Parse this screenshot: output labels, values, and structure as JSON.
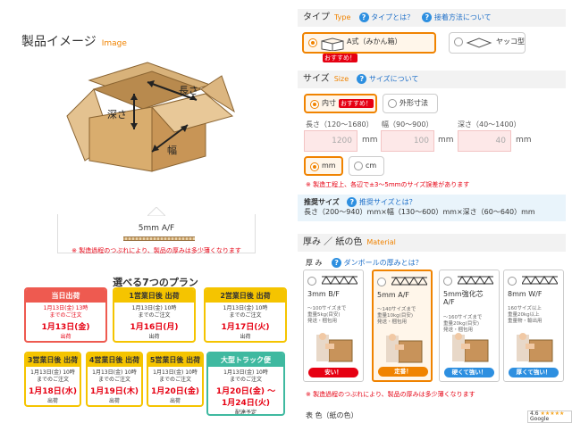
{
  "left": {
    "image_title": "製品イメージ",
    "image_title_en": "Image",
    "box_labels": {
      "length": "長さ",
      "depth": "深さ",
      "width": "幅"
    },
    "spec_name": "5mm A/F",
    "spec_note": "※ 製造過程のつぶれにより、製品の厚みは多少薄くなります",
    "plans_heading": "選べる7つのプラン",
    "plans": [
      {
        "head": "当日出荷",
        "line1": "1月13日(金) 13時",
        "line2": "までのご注文",
        "date": "1月13日(金)",
        "ship": "出荷",
        "style": "red"
      },
      {
        "head": "1営業日後 出荷",
        "line1": "1月13日(金) 10時",
        "line2": "までのご注文",
        "date": "1月16日(月)",
        "ship": "出荷",
        "style": "yellow"
      },
      {
        "head": "2営業日後 出荷",
        "line1": "1月13日(金) 10時",
        "line2": "までのご注文",
        "date": "1月17日(火)",
        "ship": "出荷",
        "style": "yellow"
      },
      {
        "head": "3営業日後 出荷",
        "line1": "1月13日(金) 10時",
        "line2": "までのご注文",
        "date": "1月18日(水)",
        "ship": "出荷",
        "style": "yellow"
      },
      {
        "head": "4営業日後 出荷",
        "line1": "1月13日(金) 10時",
        "line2": "までのご注文",
        "date": "1月19日(木)",
        "ship": "出荷",
        "style": "yellow"
      },
      {
        "head": "5営業日後 出荷",
        "line1": "1月13日(金) 10時",
        "line2": "までのご注文",
        "date": "1月20日(金)",
        "ship": "出荷",
        "style": "yellow"
      },
      {
        "head": "大型トラック便",
        "line1": "1月13日(金) 10時",
        "line2": "までのご注文",
        "date": "1月20日(金) ～",
        "date2": "1月24日(火)",
        "ship": "配達予定",
        "style": "green"
      }
    ]
  },
  "type_section": {
    "title": "タイプ",
    "title_en": "Type",
    "link1": "タイプとは？",
    "link2": "接着方法について",
    "options": [
      {
        "label": "A式（みかん箱）",
        "badge": "おすすめ！",
        "selected": true
      },
      {
        "label": "ヤッコ型",
        "selected": false
      }
    ]
  },
  "size_section": {
    "title": "サイズ",
    "title_en": "Size",
    "link": "サイズについて",
    "measure": [
      {
        "label": "内寸",
        "badge": "おすすめ！",
        "selected": true
      },
      {
        "label": "外形寸法",
        "selected": false
      }
    ],
    "length_label": "長さ（120～1680）",
    "width_label": "幅（90～900）",
    "depth_label": "深さ（40～1400）",
    "length_value": "1200",
    "width_value": "100",
    "depth_value": "40",
    "unit": "mm",
    "units": [
      {
        "label": "mm",
        "selected": true
      },
      {
        "label": "cm",
        "selected": false
      }
    ],
    "note": "※ 製造工程上、各辺で±3～5mmのサイズ誤差があります",
    "recommended_title": "推奨サイズ",
    "recommended_link": "推奨サイズとは？",
    "recommended_range": "長さ（200～940）mm×幅（130～600）mm×深さ（60～640）mm"
  },
  "thickness_section": {
    "title": "厚み ／ 紙の色",
    "title_en": "Material",
    "sub_label": "厚 み",
    "link": "ダンボールの厚みとは？",
    "cards": [
      {
        "name": "3mm B/F",
        "desc1": "～100サイズまで",
        "desc2": "重量5kg(目安)",
        "desc3": "発送・梱包用",
        "button": "安い！",
        "color": "#e60012",
        "selected": false
      },
      {
        "name": "5mm A/F",
        "desc1": "～140サイズまで",
        "desc2": "重量10kg(目安)",
        "desc3": "発送・梱包用",
        "button": "定番！",
        "color": "#f08300",
        "selected": true
      },
      {
        "name": "5mm強化芯",
        "name2": "A/F",
        "desc1": "～160サイズまで",
        "desc2": "重量20kg(目安)",
        "desc3": "発送・梱包用",
        "button": "硬くて強い！",
        "color": "#2d8fe0",
        "selected": false
      },
      {
        "name": "8mm W/F",
        "desc1": "160サイズ以上",
        "desc2": "重量20kg以上",
        "desc3": "重量物・輸出用",
        "button": "厚くて強い！",
        "color": "#2d8fe0",
        "selected": false
      }
    ],
    "note": "※ 製造過程のつぶれにより、製品の厚みは多少薄くなります",
    "paper_label": "表 色（紙の色）"
  },
  "review_badge": {
    "score": "4.6",
    "stars": "★★★★★",
    "label": "Google"
  }
}
